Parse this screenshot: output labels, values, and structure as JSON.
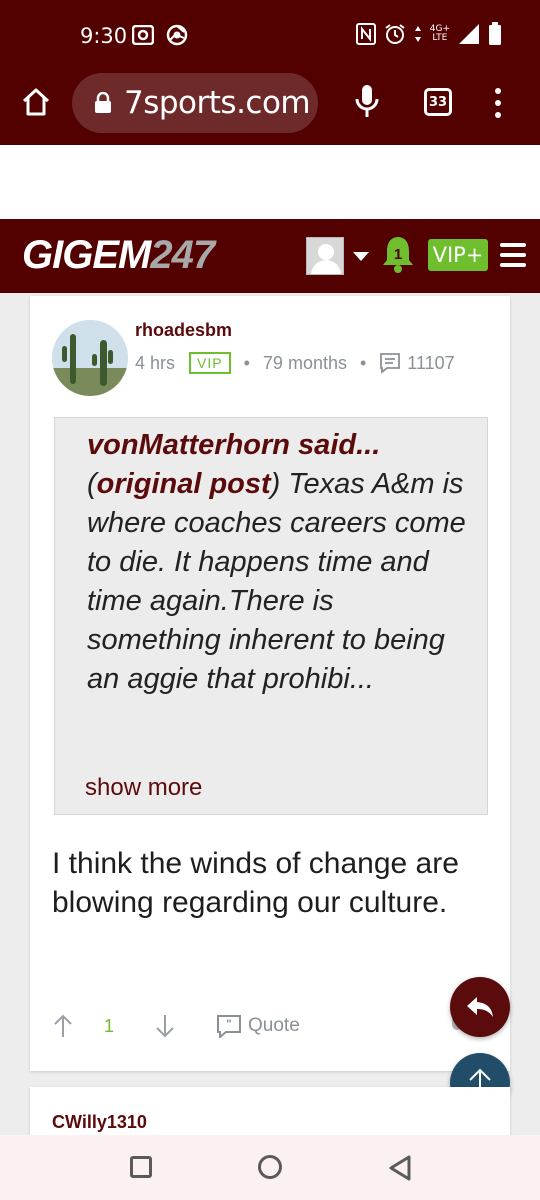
{
  "status_bar": {
    "time": "9:30",
    "left_icons": [
      "screen-record-icon",
      "chrome-icon"
    ],
    "right_icons": [
      "nfc-icon",
      "alarm-icon",
      "data-arrows-icon",
      "signal-icon",
      "battery-icon"
    ],
    "network_top": "4G+",
    "network_bottom": "LTE"
  },
  "browser": {
    "url": "7sports.com",
    "tab_count": "33",
    "icons": [
      "home-icon",
      "lock-icon",
      "mic-icon",
      "tabs-icon",
      "more-vert-icon"
    ]
  },
  "site_header": {
    "logo_main": "GIGEM",
    "logo_number": "247",
    "notification_count": "1",
    "vip_label": "VIP+",
    "colors": {
      "brand": "#520000",
      "vip": "#6ebe2d"
    }
  },
  "post": {
    "author": "rhoadesbm",
    "time_ago": "4 hrs",
    "badge": "VIP",
    "tenure": "79 months",
    "post_count": "11107",
    "quote": {
      "quoted_author": "vonMatterhorn said...",
      "original_label": "original post",
      "paren_open": "(",
      "paren_close": ")",
      "text": " Texas A&m is where coaches careers come to die. It happens time and time again.There is something inherent to being an aggie that prohibi...",
      "show_more": "show more"
    },
    "body": "I think the winds of change are blowing regarding our culture.",
    "vote_count": "1",
    "quote_button": "Quote"
  },
  "next_post": {
    "author": "CWilly1310"
  },
  "nav_bar": {
    "icons": [
      "recents-square-icon",
      "home-circle-icon",
      "back-triangle-icon"
    ]
  }
}
